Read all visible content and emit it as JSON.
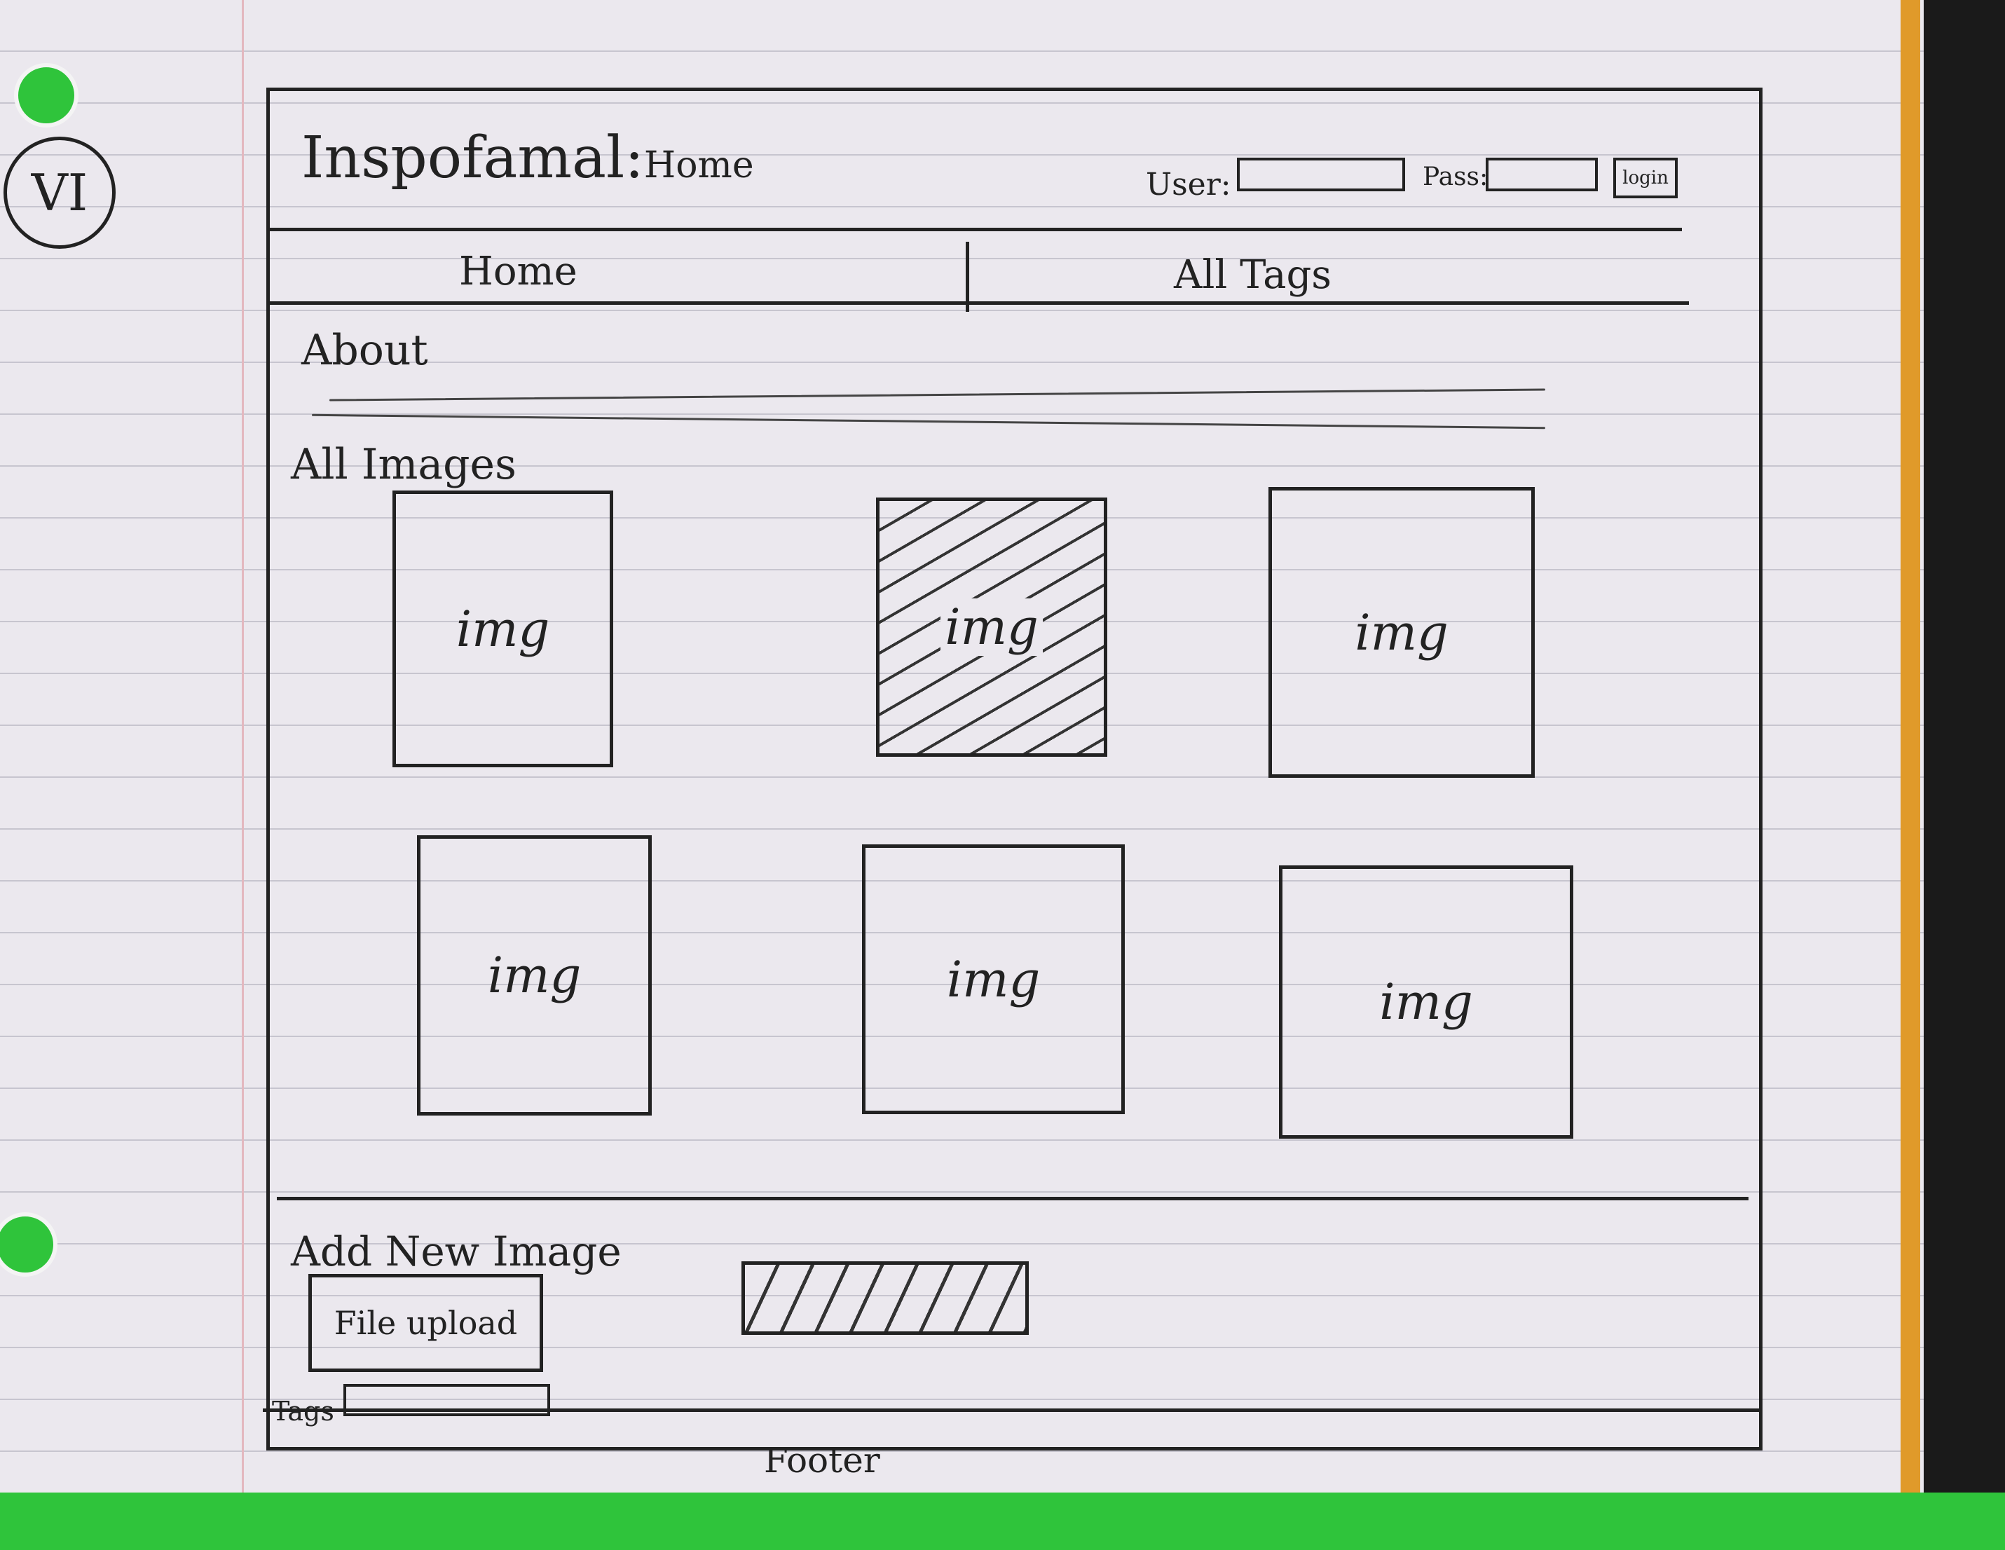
{
  "notebook": {
    "page_number": "VI"
  },
  "header": {
    "site_title": "Inspofamal:",
    "page_label": "Home",
    "user_label": "User:",
    "pass_label": "Pass:",
    "login_button": "login"
  },
  "nav": {
    "items": [
      {
        "label": "Home"
      },
      {
        "label": "All Tags"
      }
    ]
  },
  "about": {
    "heading": "About"
  },
  "gallery": {
    "heading": "All Images",
    "images": [
      {
        "label": "img",
        "selected": false
      },
      {
        "label": "img",
        "selected": true
      },
      {
        "label": "img",
        "selected": false
      },
      {
        "label": "img",
        "selected": false
      },
      {
        "label": "img",
        "selected": false
      },
      {
        "label": "img",
        "selected": false
      }
    ]
  },
  "upload": {
    "heading": "Add New Image",
    "file_upload_label": "File upload",
    "tags_label": "Tags"
  },
  "footer": {
    "text": "Footer"
  }
}
